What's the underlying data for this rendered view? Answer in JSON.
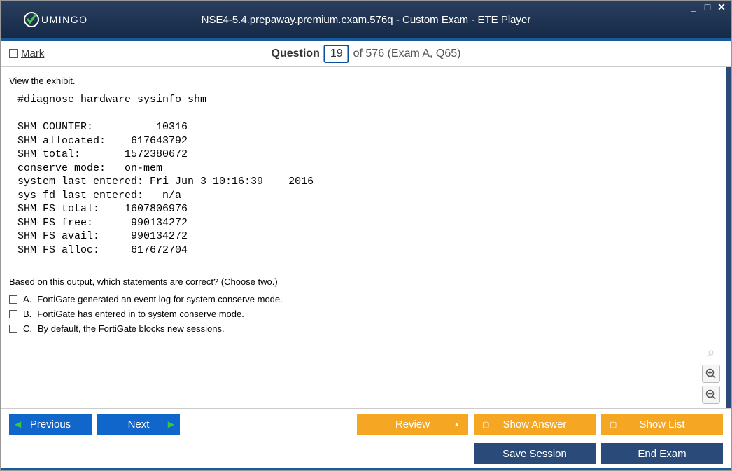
{
  "window": {
    "logo_text": "UMINGO",
    "title": "NSE4-5.4.prepaway.premium.exam.576q - Custom Exam - ETE Player"
  },
  "header": {
    "mark_label": "Mark",
    "question_label": "Question",
    "question_number": "19",
    "question_rest": "of 576 (Exam A, Q65)"
  },
  "content": {
    "exhibit_label": "View the exhibit.",
    "exhibit_text": "#diagnose hardware sysinfo shm\n\nSHM COUNTER:          10316\nSHM allocated:    617643792\nSHM total:       1572380672\nconserve mode:   on-mem\nsystem last entered: Fri Jun 3 10:16:39    2016\nsys fd last entered:   n/a\nSHM FS total:    1607806976\nSHM FS free:      990134272\nSHM FS avail:     990134272\nSHM FS alloc:     617672704",
    "prompt": "Based on this output, which statements are correct? (Choose two.)",
    "answers": [
      {
        "letter": "A.",
        "text": "FortiGate generated an event log for system conserve mode."
      },
      {
        "letter": "B.",
        "text": "FortiGate has entered in to system conserve mode."
      },
      {
        "letter": "C.",
        "text": "By default, the FortiGate blocks new sessions."
      }
    ]
  },
  "buttons": {
    "previous": "Previous",
    "next": "Next",
    "review": "Review",
    "show_answer": "Show Answer",
    "show_list": "Show List",
    "save_session": "Save Session",
    "end_exam": "End Exam"
  }
}
